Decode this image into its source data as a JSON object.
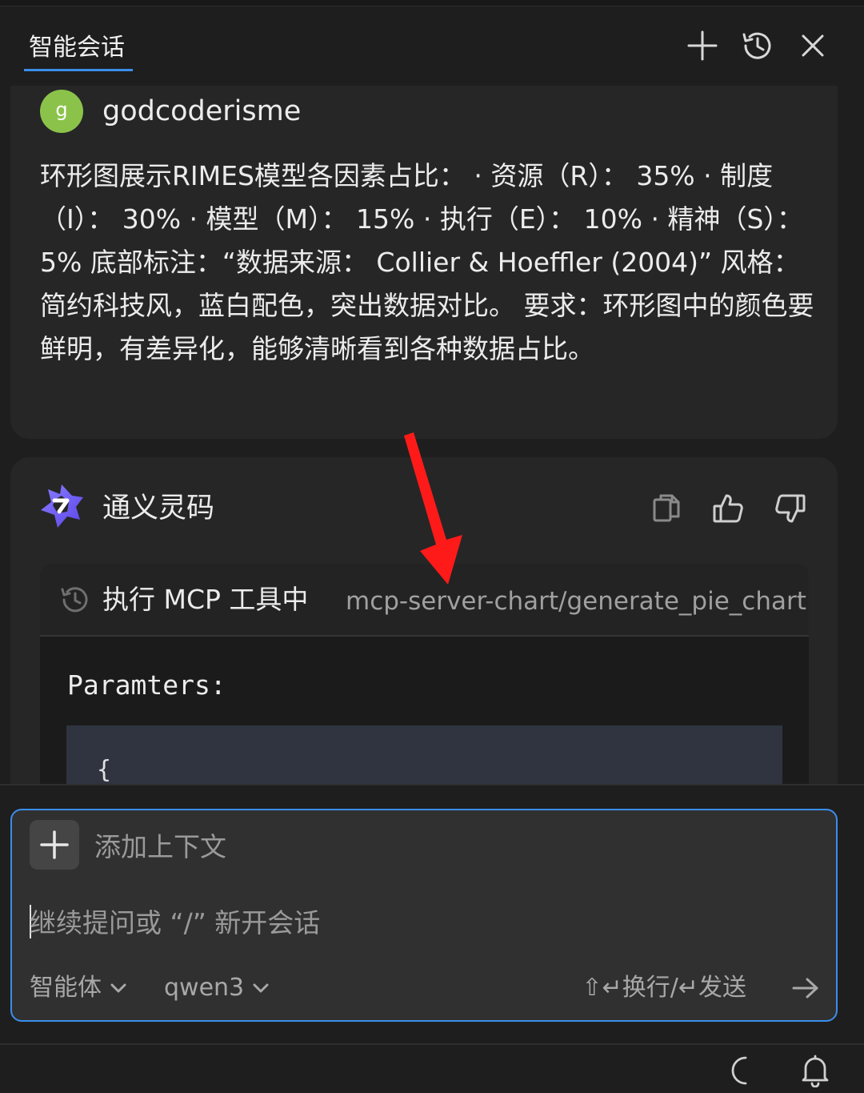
{
  "header": {
    "tab_label": "智能会话",
    "icons": [
      "plus-icon",
      "history-icon",
      "close-icon"
    ]
  },
  "user_message": {
    "avatar_letter": "g",
    "avatar_color": "#8bc34a",
    "username": "godcoderisme",
    "text": "环形图展示RIMES模型各因素占比： · 资源（R）： 35% · 制度（I）： 30% · 模型（M）： 15% · 执行（E）： 10% · 精神（S）： 5% 底部标注：“数据来源： Collier & Hoeffler (2004)” 风格：简约科技风，蓝白配色，突出数据对比。 要求：环形图中的颜色要鲜明，有差异化，能够清晰看到各种数据占比。"
  },
  "assistant": {
    "name": "通义灵码",
    "actions": [
      "copy-icon",
      "thumbs-up-icon",
      "thumbs-down-icon"
    ],
    "tool_call": {
      "title": "执行 MCP 工具中",
      "tool_name": "mcp-server-chart/generate_pie_chart",
      "params_label": "Paramters:",
      "code_first_line": "{"
    }
  },
  "input": {
    "add_context_label": "添加上下文",
    "placeholder": "继续提问或 “/” 新开会话",
    "value": "",
    "mode_label": "智能体",
    "model_label": "qwen3",
    "hint": "⇧↵换行/↵发送"
  },
  "colors": {
    "accent": "#3b8eea",
    "annotation_arrow": "#ff1a1a",
    "background": "#1e1e1e",
    "card": "#262626"
  }
}
